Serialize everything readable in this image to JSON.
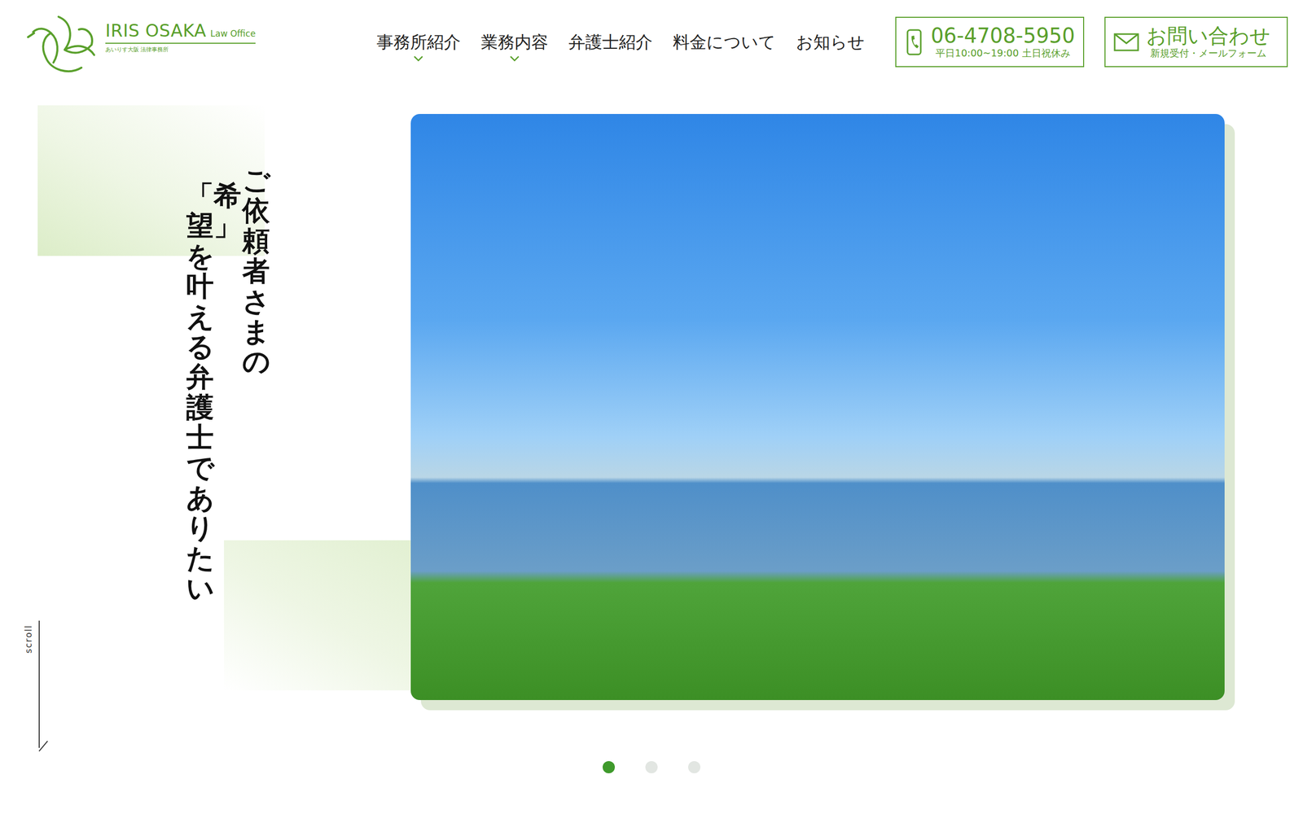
{
  "logo": {
    "name": "IRIS OSAKA",
    "suffix": "Law Office",
    "subtitle": "あいりす大阪 法律事務所"
  },
  "nav": [
    {
      "label": "事務所紹介",
      "has_submenu": true
    },
    {
      "label": "業務内容",
      "has_submenu": true
    },
    {
      "label": "弁護士紹介",
      "has_submenu": false
    },
    {
      "label": "料金について",
      "has_submenu": false
    },
    {
      "label": "お知らせ",
      "has_submenu": false
    }
  ],
  "phone": {
    "number": "06-4708-5950",
    "hours": "平日10:00~19:00 土日祝休み"
  },
  "contact": {
    "label": "お問い合わせ",
    "sub": "新規受付・メールフォーム"
  },
  "hero": {
    "lines": [
      "ご依頼者さまの",
      "「希望」を叶える弁護士でありたい"
    ]
  },
  "scroll": "scroll",
  "slides": [
    {
      "selected": true
    },
    {
      "selected": false
    },
    {
      "selected": false
    }
  ]
}
